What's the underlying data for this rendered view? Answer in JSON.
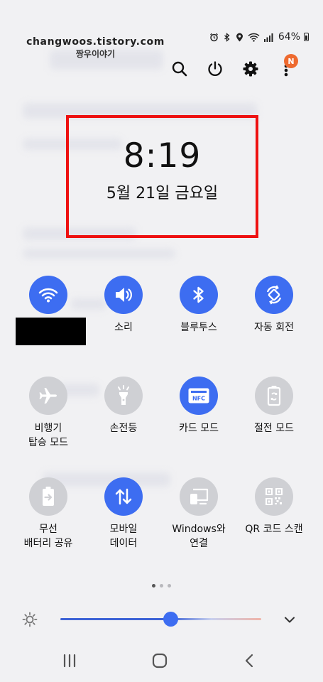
{
  "watermark": {
    "line1": "changwoos.tistory.com",
    "line2": "짱우이야기"
  },
  "status_bar": {
    "icons": [
      "alarm-icon",
      "bluetooth-icon",
      "location-icon",
      "wifi-icon",
      "signal-icon",
      "battery-icon"
    ],
    "battery_text": "64%"
  },
  "top_actions": [
    "search-icon",
    "power-icon",
    "settings-icon",
    "more-options-icon"
  ],
  "notification_badge": "N",
  "clock": {
    "time": "8:19",
    "date": "5월 21일 금요일"
  },
  "tiles": [
    {
      "id": "wifi",
      "label": "",
      "icon": "wifi-icon",
      "active": true
    },
    {
      "id": "sound",
      "label": "소리",
      "icon": "speaker-icon",
      "active": true
    },
    {
      "id": "bluetooth",
      "label": "블루투스",
      "icon": "bluetooth-icon",
      "active": true
    },
    {
      "id": "auto-rotate",
      "label": "자동 회전",
      "icon": "rotate-icon",
      "active": true
    },
    {
      "id": "airplane",
      "label": "비행기\n탑승 모드",
      "icon": "airplane-icon",
      "active": false
    },
    {
      "id": "flashlight",
      "label": "손전등",
      "icon": "flashlight-icon",
      "active": false
    },
    {
      "id": "nfc",
      "label": "카드 모드",
      "icon": "nfc-icon",
      "icon_text": "NFC",
      "active": true
    },
    {
      "id": "power-saving",
      "label": "절전 모드",
      "icon": "power-saving-icon",
      "active": false
    },
    {
      "id": "wireless-powershare",
      "label": "무선\n배터리 공유",
      "icon": "wireless-powershare-icon",
      "active": false
    },
    {
      "id": "mobile-data",
      "label": "모바일\n데이터",
      "icon": "mobile-data-icon",
      "active": true
    },
    {
      "id": "link-to-windows",
      "label": "Windows와\n연결",
      "icon": "link-to-windows-icon",
      "active": false
    },
    {
      "id": "qr-scanner",
      "label": "QR 코드 스캔",
      "icon": "qr-code-icon",
      "active": false
    }
  ],
  "pager": {
    "pages": 3,
    "current": 1
  },
  "brightness": {
    "level": 0.55,
    "icon": "brightness-icon",
    "expand_icon": "chevron-down-icon"
  },
  "navigation_bar": [
    "recent-apps-icon",
    "home-icon",
    "back-icon"
  ],
  "colors": {
    "accent": "#3d6df1",
    "tile_off": "#cfd0d4",
    "highlight": "#ee1111",
    "badge": "#ee6a2f"
  }
}
